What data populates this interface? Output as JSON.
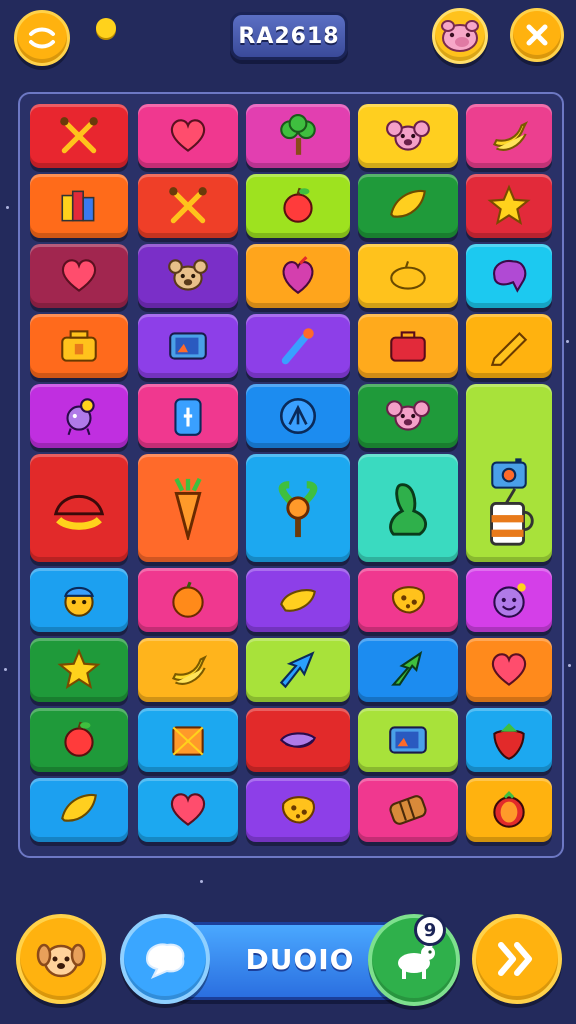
{
  "header": {
    "title": "RA2618",
    "menu_icon": "swap-arrows-icon",
    "avatar_icon": "pig-face-icon",
    "close_icon": "close-icon",
    "coin_icon": "coin-icon"
  },
  "board": {
    "tiles": [
      {
        "icon": "crossed-tools-icon",
        "color": "#e8262f"
      },
      {
        "icon": "heart-icon",
        "color": "#f0388f"
      },
      {
        "icon": "tree-icon",
        "color": "#e23fb0"
      },
      {
        "icon": "koala-icon",
        "color": "#ffcf1f"
      },
      {
        "icon": "banana-icon",
        "color": "#ec3f8f"
      },
      {
        "icon": "blocks-icon",
        "color": "#ff6b1a"
      },
      {
        "icon": "crossed-tools-icon",
        "color": "#ef3f28"
      },
      {
        "icon": "apple-icon",
        "color": "#9ee21f"
      },
      {
        "icon": "leaf-icon",
        "color": "#1f9a3a"
      },
      {
        "icon": "star-icon",
        "color": "#e22a3a"
      },
      {
        "icon": "heart-icon",
        "color": "#a1264f"
      },
      {
        "icon": "bear-icon",
        "color": "#7a2fc8"
      },
      {
        "icon": "heart-fruit-icon",
        "color": "#ffa51c"
      },
      {
        "icon": "lemon-icon",
        "color": "#ffc21c"
      },
      {
        "icon": "blob-icon",
        "color": "#1cc9f0"
      },
      {
        "icon": "radio-icon",
        "color": "#ff6a1c"
      },
      {
        "icon": "tablet-icon",
        "color": "#8d3fe8"
      },
      {
        "icon": "brush-icon",
        "color": "#8d3fe8"
      },
      {
        "icon": "suitcase-icon",
        "color": "#ffaa1c"
      },
      {
        "icon": "pencil-icon",
        "color": "#ffb20f"
      },
      {
        "icon": "critter-icon",
        "color": "#c02fe0"
      },
      {
        "icon": "phone-icon",
        "color": "#f0388f"
      },
      {
        "icon": "compass-icon",
        "color": "#1c8cf0"
      },
      {
        "icon": "koala-icon",
        "color": "#1f9a3a"
      },
      {
        "icon": "camera-icon",
        "color": "#a8e23a"
      },
      {
        "icon": "watermelon-icon",
        "color": "#e22a2a"
      },
      {
        "icon": "carrot-icon",
        "color": "#ff6a2a"
      },
      {
        "icon": "orange-tree-icon",
        "color": "#1ca8f0"
      },
      {
        "icon": "squid-icon",
        "color": "#3adac0"
      },
      {
        "icon": "cup-icon",
        "color": "#a8e23a"
      },
      {
        "icon": "face-icon",
        "color": "#1ca0f0"
      },
      {
        "icon": "orange-icon",
        "color": "#f0388f"
      },
      {
        "icon": "mango-icon",
        "color": "#8d3fe8"
      },
      {
        "icon": "cookie-icon",
        "color": "#f0388f"
      },
      {
        "icon": "smiley-icon",
        "color": "#d43fe8"
      },
      {
        "icon": "star-icon",
        "color": "#1f9a3a"
      },
      {
        "icon": "banana-icon",
        "color": "#ffb41c"
      },
      {
        "icon": "arrow-leaf-icon",
        "color": "#a8e23a"
      },
      {
        "icon": "palm-leaf-icon",
        "color": "#1c8cf0"
      },
      {
        "icon": "heart-icon",
        "color": "#ff8a1c"
      },
      {
        "icon": "apple-icon",
        "color": "#1f9a3a"
      },
      {
        "icon": "box-icon",
        "color": "#1ca8f0"
      },
      {
        "icon": "eggplant-icon",
        "color": "#e22a2a"
      },
      {
        "icon": "tablet-icon",
        "color": "#a8e23a"
      },
      {
        "icon": "strawberry-icon",
        "color": "#1ca8f0"
      },
      {
        "icon": "leaf-icon",
        "color": "#1ca0f0"
      },
      {
        "icon": "heart-icon",
        "color": "#1ca8f0"
      },
      {
        "icon": "cookie-icon",
        "color": "#8d3fe8"
      },
      {
        "icon": "roll-icon",
        "color": "#f0388f"
      },
      {
        "icon": "tomato-icon",
        "color": "#ffb20f"
      }
    ]
  },
  "footer": {
    "action_label": "DUOIO",
    "badge_count": "9",
    "pet_icon": "dog-icon",
    "chat_icon": "chat-bubble-icon",
    "goat_icon": "goat-icon",
    "next_icon": "double-chevron-right-icon"
  }
}
